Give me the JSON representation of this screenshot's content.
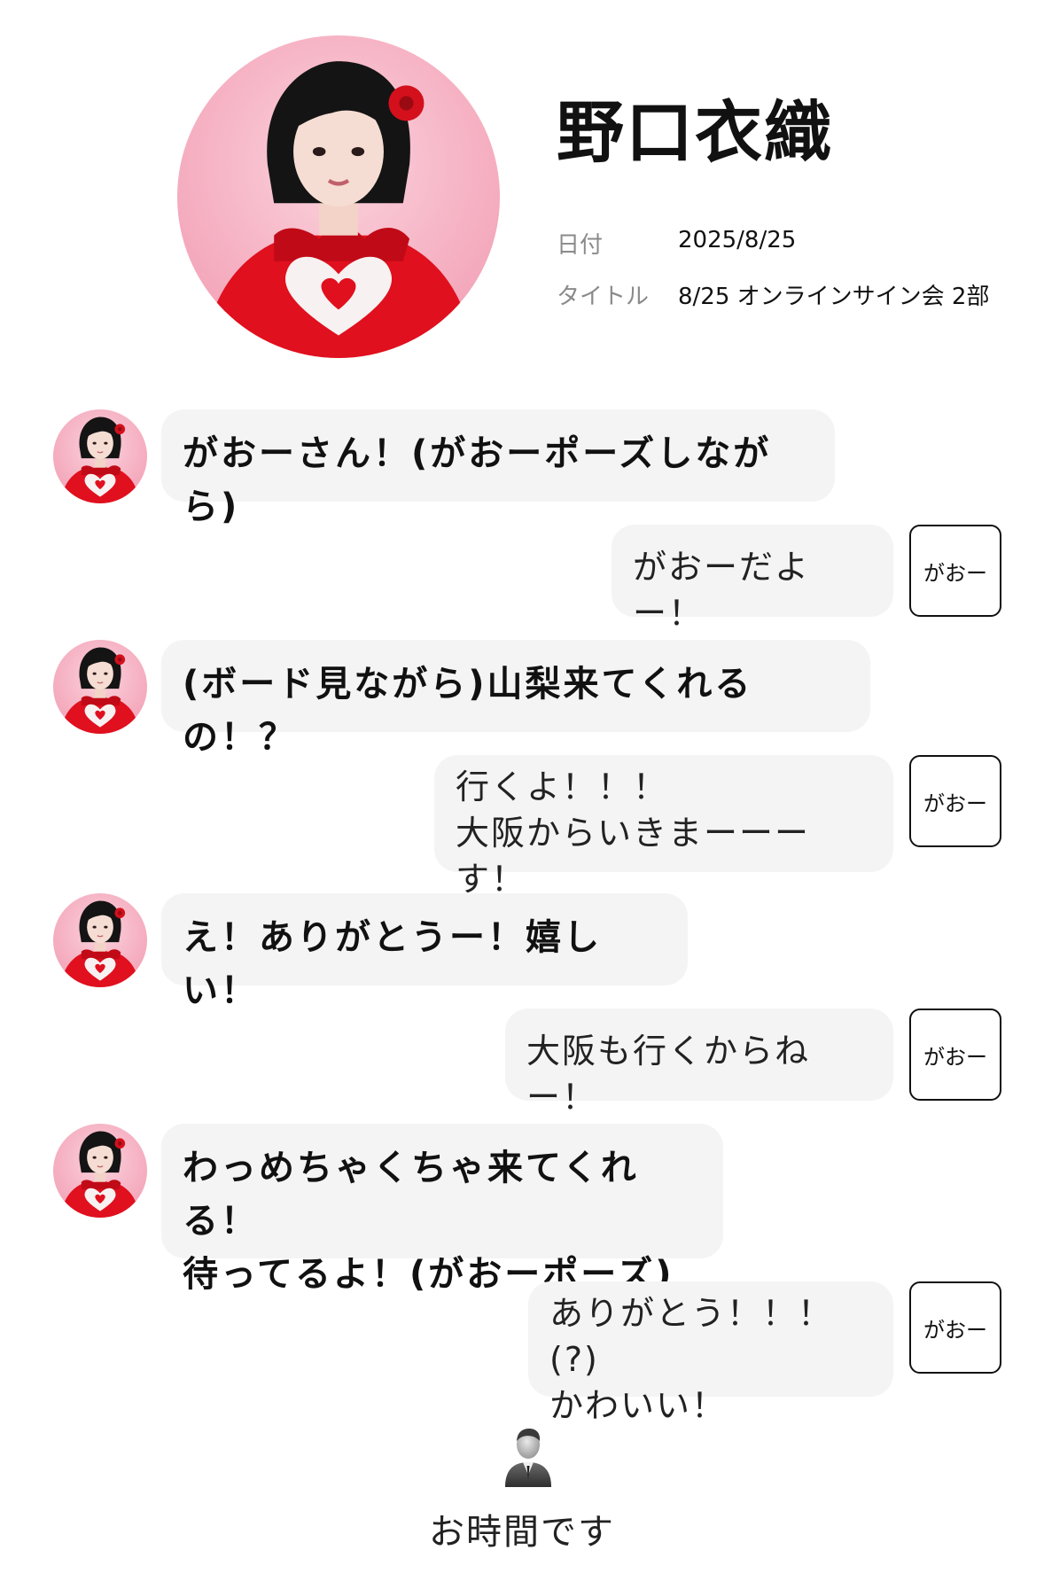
{
  "profile": {
    "name": "野口衣織",
    "date_label": "日付",
    "date_value": "2025/8/25",
    "title_label": "タイトル",
    "title_value": "8/25 オンラインサイン会 2部"
  },
  "messages": [
    {
      "from": "idol",
      "text": "がおーさん！(がおーポーズしながら)"
    },
    {
      "from": "fan",
      "text": "がおーだよー！",
      "tag": "がおー"
    },
    {
      "from": "idol",
      "text": "(ボード見ながら)山梨来てくれるの！？"
    },
    {
      "from": "fan",
      "text": "行くよ！！！\n大阪からいきまーーーす！",
      "tag": "がおー"
    },
    {
      "from": "idol",
      "text": "え！ありがとうー！嬉しい！"
    },
    {
      "from": "fan",
      "text": "大阪も行くからねー！",
      "tag": "がおー"
    },
    {
      "from": "idol",
      "text": "わっめちゃくちゃ来てくれる！\n待ってるよ！(がおーポーズ)"
    },
    {
      "from": "fan",
      "text": "ありがとう！！！(?)\nかわいい！",
      "tag": "がおー"
    }
  ],
  "footer": {
    "text": "お時間です"
  },
  "colors": {
    "bubble": "#f4f4f4",
    "accent_red": "#e0101e",
    "bg_pink": "#f7b7c7"
  }
}
